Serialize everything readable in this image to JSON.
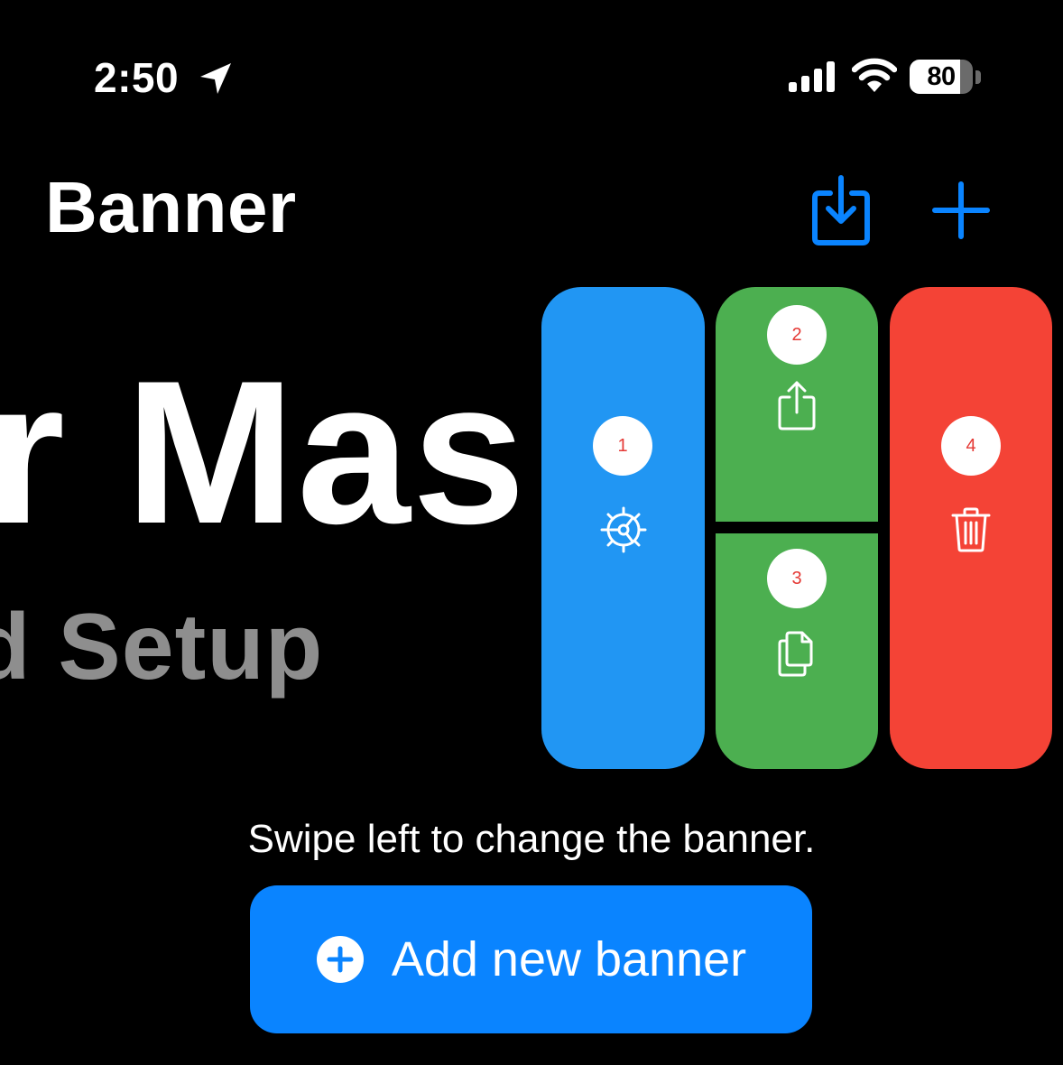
{
  "status_bar": {
    "time": "2:50",
    "battery": "80",
    "battery_level": 0.8
  },
  "nav": {
    "title": "Banner"
  },
  "banner_preview": {
    "main_text": "r Mas",
    "sub_text": "d Setup"
  },
  "actions": [
    {
      "badge": "1",
      "icon": "gear-icon",
      "color": "#2196f3"
    },
    {
      "badge": "2",
      "icon": "share-icon",
      "color": "#4caf50"
    },
    {
      "badge": "3",
      "icon": "copy-icon",
      "color": "#4caf50"
    },
    {
      "badge": "4",
      "icon": "trash-icon",
      "color": "#f44336"
    }
  ],
  "hint": "Swipe left to change the banner.",
  "add_button": {
    "label": "Add new banner",
    "icon": "plus-circle-icon",
    "color": "#0a84ff"
  },
  "colors": {
    "accent": "#0a84ff",
    "background": "#000000",
    "secondary_text": "#8e8e8e"
  }
}
